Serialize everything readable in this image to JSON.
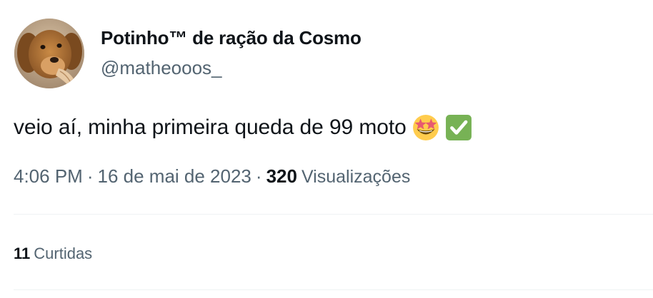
{
  "author": {
    "display_name": "Potinho™ de ração da Cosmo",
    "handle": "@matheooos_",
    "avatar": "dog-photo-avatar"
  },
  "tweet": {
    "text": "veio aí, minha primeira queda de 99 moto",
    "emojis": [
      "star-struck-emoji",
      "check-mark-button-emoji"
    ]
  },
  "meta": {
    "time": "4:06 PM",
    "separator": "·",
    "date": "16 de mai de 2023",
    "views_count": "320",
    "views_label": "Visualizações"
  },
  "engagement": {
    "likes_count": "11",
    "likes_label": "Curtidas"
  },
  "colors": {
    "text_primary": "#0f1419",
    "text_secondary": "#536471",
    "divider": "#eff3f4",
    "check_green": "#77b255"
  }
}
